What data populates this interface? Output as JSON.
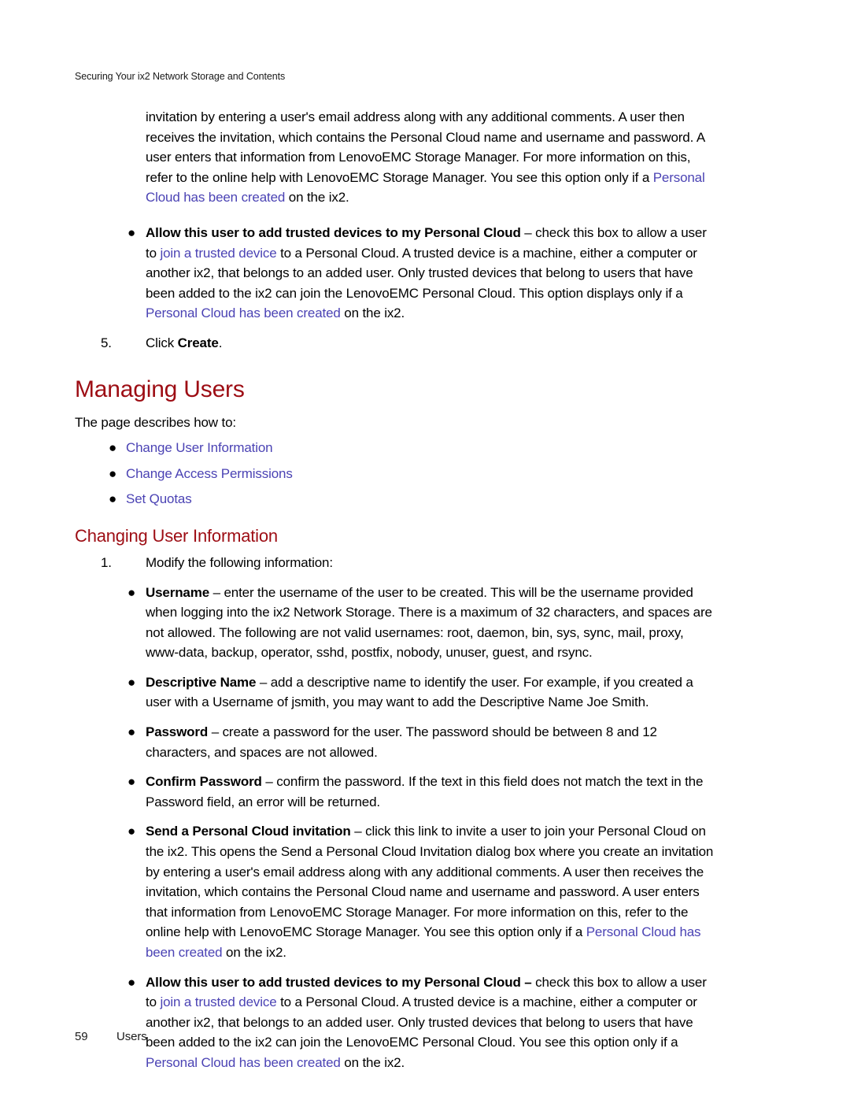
{
  "header": {
    "running_title": "Securing Your ix2 Network Storage and Contents"
  },
  "colors": {
    "heading_red": "#9d0d14",
    "link_blue": "#4b43b4",
    "body_text": "#000000",
    "page_background": "#ffffff"
  },
  "intro_paragraph": {
    "text_before_link": "invitation by entering a user's email address along with any additional comments. A user then receives the invitation, which contains the Personal Cloud name and username and password. A user enters that information from LenovoEMC Storage Manager. For more information on this, refer to the online help with LenovoEMC Storage Manager. You see this option only if a ",
    "link": "Personal Cloud has been created",
    "text_after_link": " on the ix2."
  },
  "trusted_devices_bullet_top": {
    "bullet_glyph": "●",
    "term": "Allow this user to add trusted devices to my Personal Cloud",
    "dash": " – ",
    "text_1": "check this box to allow a user to ",
    "link_1": "join a trusted device",
    "text_2": " to a Personal Cloud. A trusted device is a machine, either a computer or another ix2, that belongs to an added user. Only trusted devices that belong to users that have been added to the ix2 can join the LenovoEMC Personal Cloud. This option displays only if a ",
    "link_2": "Personal Cloud has been created",
    "text_3": " on the ix2."
  },
  "step_five": {
    "number": "5.",
    "text_before": "Click ",
    "bold_term": "Create",
    "text_after": "."
  },
  "managing_users": {
    "heading": "Managing Users",
    "lead": "The page describes how to:",
    "links": [
      {
        "bullet_glyph": "●",
        "label": "Change User Information"
      },
      {
        "bullet_glyph": "●",
        "label": "Change Access Permissions"
      },
      {
        "bullet_glyph": "●",
        "label": "Set Quotas"
      }
    ]
  },
  "changing_user_information": {
    "heading": "Changing User Information",
    "step": {
      "number": "1.",
      "text": "Modify the following information:"
    },
    "bullets": {
      "username": {
        "bullet_glyph": "●",
        "term": "Username",
        "dash": " – ",
        "text": "enter the username of the user to be created. This will be the username provided when logging into the ix2 Network Storage. There is a maximum of 32 characters, and spaces are not allowed. The following are not valid usernames: root, daemon, bin, sys, sync, mail, proxy, www-data, backup, operator, sshd, postfix, nobody, unuser, guest, and rsync."
      },
      "descriptive_name": {
        "bullet_glyph": "●",
        "term": "Descriptive Name",
        "dash": " – ",
        "text": "add a descriptive name to identify the user. For example, if you created a user with a Username of jsmith, you may want to add the Descriptive Name Joe Smith."
      },
      "password": {
        "bullet_glyph": "●",
        "term": "Password",
        "dash": " – ",
        "text": "create a password for the user. The password should be between 8 and 12 characters, and spaces are not allowed."
      },
      "confirm_password": {
        "bullet_glyph": "●",
        "term": "Confirm Password",
        "dash": " – ",
        "text": "confirm the password. If the text in this field does not match the text in the Password field, an error will be returned."
      },
      "send_invitation": {
        "bullet_glyph": "●",
        "term": "Send a Personal Cloud invitation",
        "dash": " – ",
        "text_before_link": "click this link to invite a user to join your Personal Cloud on the ix2. This opens the Send a Personal Cloud Invitation dialog box where you create an invitation by entering a user's email address along with any additional comments. A user then receives the invitation, which contains the Personal Cloud name and username and password. A user enters that information from LenovoEMC Storage Manager. For more information on this, refer to the online help with LenovoEMC Storage Manager. You see this option only if a ",
        "link": "Personal Cloud has been created",
        "text_after_link": " on the ix2."
      },
      "trusted_devices": {
        "bullet_glyph": "●",
        "term": "Allow this user to add trusted devices to my Personal Cloud –",
        "text_1": " check this box to allow a user to ",
        "link_1": "join a trusted device",
        "text_2": " to a Personal Cloud. A trusted device is a machine, either a computer or another ix2, that belongs to an added user. Only trusted devices that belong to users that have been added to the ix2 can join the LenovoEMC Personal Cloud. You see this option only if a ",
        "link_2": "Personal Cloud has been created",
        "text_3": " on the ix2."
      }
    }
  },
  "footer": {
    "page_number": "59",
    "section": "Users"
  }
}
